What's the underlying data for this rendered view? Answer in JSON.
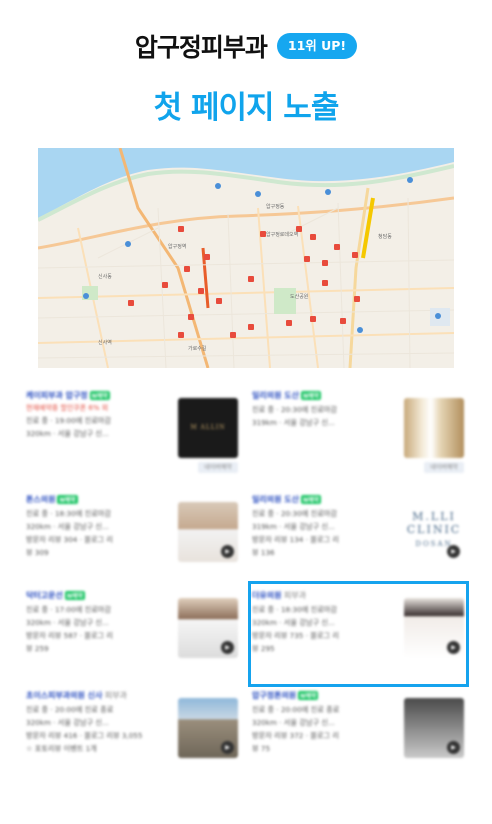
{
  "header": {
    "keyword": "압구정피부과",
    "rank_badge": "11위 UP!"
  },
  "headline": "첫 페이지 노출",
  "map": {
    "labels": [
      "압구정동",
      "신사동",
      "압구정로데오역",
      "청담동",
      "도산공원",
      "압구정역",
      "신사역",
      "가로수길"
    ]
  },
  "results": [
    {
      "name": "케이피부과 압구정",
      "promo": "현재예약중 할인쿠폰 6% 외",
      "lines": [
        "진료 중 · 19:00에 진료마감",
        "320km · 서울 강남구 신..."
      ],
      "thumb_tag": "네이버예약",
      "npay": "N예약",
      "thumb_style": "logo-dark"
    },
    {
      "name": "일리의원 도산",
      "promo": "",
      "lines": [
        "진료 중 · 20:30에 진료마감",
        "319km · 서울 강남구 신..."
      ],
      "thumb_tag": "네이버예약",
      "npay": "N예약",
      "thumb_style": "interior-gold"
    },
    {
      "name": "톤스의원",
      "promo": "",
      "lines": [
        "진료 중 · 18:30에 진료마감",
        "320km · 서울 강남구 신...",
        "방문자 리뷰 304 · 블로그 리",
        "뷰 309"
      ],
      "thumb_tag": "",
      "npay": "N예약",
      "thumb_style": "portrait"
    },
    {
      "name": "일리의원 도산",
      "promo": "",
      "lines": [
        "진료 중 · 20:30에 진료마감",
        "319km · 서울 강남구 신...",
        "방문자 리뷰 134 · 블로그 리",
        "뷰 136"
      ],
      "thumb_tag": "",
      "npay": "N예약",
      "thumb_style": "clinic-logo"
    },
    {
      "name": "닥터고운선",
      "promo": "",
      "lines": [
        "진료 중 · 17:00에 진료마감",
        "320km · 서울 강남구 신...",
        "방문자 리뷰 587 · 블로그 리",
        "뷰 259"
      ],
      "thumb_tag": "",
      "npay": "N예약",
      "thumb_style": "doctor"
    },
    {
      "name": "더유의원",
      "sub": "피부과",
      "promo": "",
      "lines": [
        "진료 중 · 18:30에 진료마감",
        "320km · 서울 강남구 신...",
        "방문자 리뷰 735 · 블로그 리",
        "뷰 295"
      ],
      "thumb_tag": "",
      "npay": "",
      "thumb_style": "doctor-woman"
    },
    {
      "name": "초이스피부과의원 신사",
      "sub": "피부과",
      "promo": "",
      "lines": [
        "진료 중 · 20:00에 진료 종료",
        "320km · 서울 강남구 신...",
        "방문자 리뷰 416 · 블로그 리뷰 3,055",
        "☆ 포토리뷰 이벤트 1개"
      ],
      "thumb_tag": "",
      "npay": "",
      "thumb_style": "building"
    },
    {
      "name": "압구정톤의원",
      "promo": "",
      "lines": [
        "진료 중 · 20:00에 진료 종료",
        "320km · 서울 강남구 신...",
        "방문자 리뷰 372 · 블로그 리",
        "뷰 75"
      ],
      "thumb_tag": "",
      "npay": "N예약",
      "thumb_style": "lobby"
    }
  ],
  "colors": {
    "accent": "#10a4ec",
    "badge": "#16a7f0",
    "highlight": "#15a3ee",
    "map_pin": "#e84b3c"
  },
  "icons": {
    "play": "video-play-icon",
    "pin": "map-pin-icon"
  }
}
